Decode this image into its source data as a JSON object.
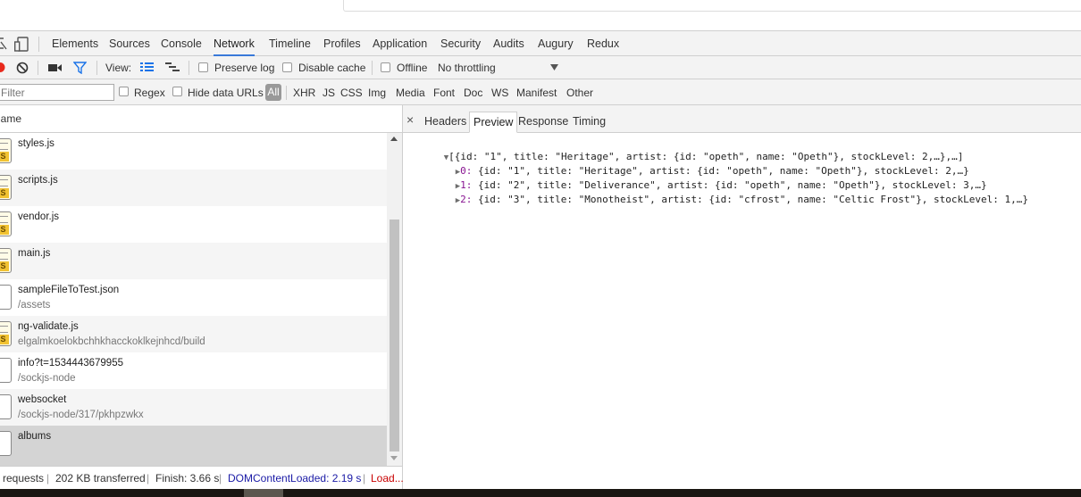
{
  "tabs": [
    "Elements",
    "Sources",
    "Console",
    "Network",
    "Timeline",
    "Profiles",
    "Application",
    "Security",
    "Audits",
    "Augury",
    "Redux"
  ],
  "active_tab": "Network",
  "netbar": {
    "view_label": "View:",
    "preserve_log": "Preserve log",
    "disable_cache": "Disable cache",
    "offline": "Offline",
    "throttling": "No throttling"
  },
  "filterbar": {
    "filter_placeholder": "Filter",
    "regex": "Regex",
    "hide_data_urls": "Hide data URLs",
    "all": "All",
    "types": [
      "XHR",
      "JS",
      "CSS",
      "Img",
      "Media",
      "Font",
      "Doc",
      "WS",
      "Manifest",
      "Other"
    ]
  },
  "list_header": "Name",
  "requests": [
    {
      "name": "styles.js",
      "path": "",
      "type": "js"
    },
    {
      "name": "scripts.js",
      "path": "",
      "type": "js"
    },
    {
      "name": "vendor.js",
      "path": "",
      "type": "js"
    },
    {
      "name": "main.js",
      "path": "",
      "type": "js"
    },
    {
      "name": "sampleFileToTest.json",
      "path": "/assets",
      "type": "doc"
    },
    {
      "name": "ng-validate.js",
      "path": "elgalmkoelokbchhkhacckoklkejnhcd/build",
      "type": "js"
    },
    {
      "name": "info?t=1534443679955",
      "path": "/sockjs-node",
      "type": "doc"
    },
    {
      "name": "websocket",
      "path": "/sockjs-node/317/pkhpzwkx",
      "type": "doc"
    },
    {
      "name": "albums",
      "path": "",
      "type": "doc"
    }
  ],
  "selected_request": "albums",
  "status": {
    "requests": "requests",
    "transferred": "202 KB transferred",
    "finish": "Finish: 3.66 s",
    "domcontentloaded": "DOMContentLoaded: 2.19 s",
    "load": "Load...",
    "domcontentloaded_color": "#1a1aa6",
    "load_color": "#c80000"
  },
  "detail_tabs": {
    "close": "×",
    "items": [
      "Headers",
      "Preview",
      "Response",
      "Timing"
    ],
    "active": "Preview"
  },
  "preview": {
    "root": "[{id: \"1\", title: \"Heritage\", artist: {id: \"opeth\", name: \"Opeth\"}, stockLevel: 2,…},…]",
    "items": [
      {
        "index": "0",
        "text": "{id: \"1\", title: \"Heritage\", artist: {id: \"opeth\", name: \"Opeth\"}, stockLevel: 2,…}"
      },
      {
        "index": "1",
        "text": "{id: \"2\", title: \"Deliverance\", artist: {id: \"opeth\", name: \"Opeth\"}, stockLevel: 3,…}"
      },
      {
        "index": "2",
        "text": "{id: \"3\", title: \"Monotheist\", artist: {id: \"cfrost\", name: \"Celtic Frost\"}, stockLevel: 1,…}"
      }
    ]
  },
  "colors": {
    "accent": "#3879d9",
    "record": "#e8291c",
    "filter_icon": "#1a73e8"
  },
  "icons": [
    "inspect-icon",
    "device-mode-icon",
    "record-icon",
    "clear-icon",
    "camera-icon",
    "filter-icon",
    "list-view-icon",
    "waterfall-view-icon",
    "dropdown-arrow-icon",
    "close-icon",
    "expand-triangle-icon"
  ]
}
